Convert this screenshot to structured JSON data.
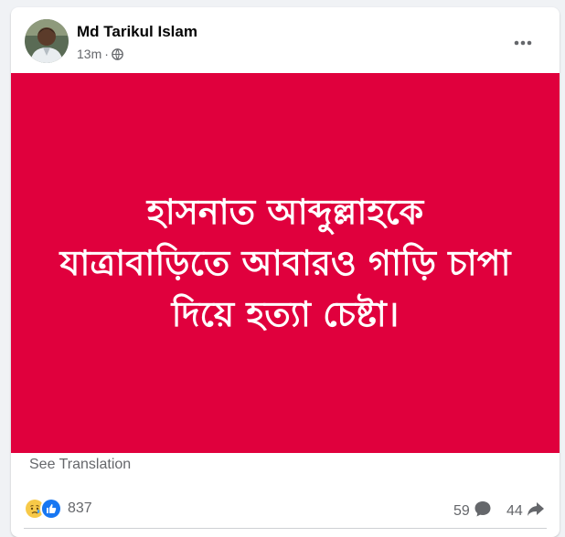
{
  "post": {
    "author": "Md Tarikul Islam",
    "timestamp": "13m",
    "separator": "·",
    "privacy_icon": "globe-icon",
    "more_icon": "more-icon"
  },
  "media": {
    "lines": [
      "হাসনাত আব্দুল্লাহকে",
      "যাত্রাবাড়িতে আবারও গাড়ি চাপা",
      "দিয়ে হত্যা চেষ্টা।"
    ],
    "background_color": "#e0003d",
    "text_color": "#ffffff"
  },
  "see_translation": "See Translation",
  "stats": {
    "reaction_icons": [
      "sad-reaction-icon",
      "like-reaction-icon"
    ],
    "reaction_count": "837",
    "comment_count": "59",
    "share_count": "44"
  }
}
